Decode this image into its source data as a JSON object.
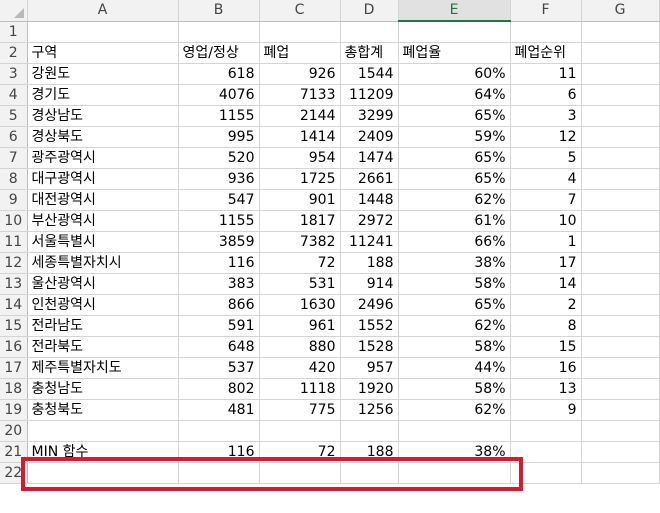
{
  "columns": [
    "A",
    "B",
    "C",
    "D",
    "E",
    "F",
    "G"
  ],
  "highlight_color": "#d9192d",
  "header_row": {
    "row_number": "2",
    "cells": [
      "구역",
      "영업/정상",
      "폐업",
      "총합계",
      "폐업율",
      "폐업순위",
      ""
    ]
  },
  "data_rows": [
    {
      "row_number": "3",
      "cells": [
        "강원도",
        "618",
        "926",
        "1544",
        "60%",
        "11",
        ""
      ]
    },
    {
      "row_number": "4",
      "cells": [
        "경기도",
        "4076",
        "7133",
        "11209",
        "64%",
        "6",
        ""
      ]
    },
    {
      "row_number": "5",
      "cells": [
        "경상남도",
        "1155",
        "2144",
        "3299",
        "65%",
        "3",
        ""
      ]
    },
    {
      "row_number": "6",
      "cells": [
        "경상북도",
        "995",
        "1414",
        "2409",
        "59%",
        "12",
        ""
      ]
    },
    {
      "row_number": "7",
      "cells": [
        "광주광역시",
        "520",
        "954",
        "1474",
        "65%",
        "5",
        ""
      ]
    },
    {
      "row_number": "8",
      "cells": [
        "대구광역시",
        "936",
        "1725",
        "2661",
        "65%",
        "4",
        ""
      ]
    },
    {
      "row_number": "9",
      "cells": [
        "대전광역시",
        "547",
        "901",
        "1448",
        "62%",
        "7",
        ""
      ]
    },
    {
      "row_number": "10",
      "cells": [
        "부산광역시",
        "1155",
        "1817",
        "2972",
        "61%",
        "10",
        ""
      ]
    },
    {
      "row_number": "11",
      "cells": [
        "서울특별시",
        "3859",
        "7382",
        "11241",
        "66%",
        "1",
        ""
      ]
    },
    {
      "row_number": "12",
      "cells": [
        "세종특별자치시",
        "116",
        "72",
        "188",
        "38%",
        "17",
        ""
      ]
    },
    {
      "row_number": "13",
      "cells": [
        "울산광역시",
        "383",
        "531",
        "914",
        "58%",
        "14",
        ""
      ]
    },
    {
      "row_number": "14",
      "cells": [
        "인천광역시",
        "866",
        "1630",
        "2496",
        "65%",
        "2",
        ""
      ]
    },
    {
      "row_number": "15",
      "cells": [
        "전라남도",
        "591",
        "961",
        "1552",
        "62%",
        "8",
        ""
      ]
    },
    {
      "row_number": "16",
      "cells": [
        "전라북도",
        "648",
        "880",
        "1528",
        "58%",
        "15",
        ""
      ]
    },
    {
      "row_number": "17",
      "cells": [
        "제주특별자치도",
        "537",
        "420",
        "957",
        "44%",
        "16",
        ""
      ]
    },
    {
      "row_number": "18",
      "cells": [
        "충청남도",
        "802",
        "1118",
        "1920",
        "58%",
        "13",
        ""
      ]
    },
    {
      "row_number": "19",
      "cells": [
        "충청북도",
        "481",
        "775",
        "1256",
        "62%",
        "9",
        ""
      ]
    }
  ],
  "row_1": {
    "row_number": "1"
  },
  "row_20": {
    "row_number": "20"
  },
  "min_row": {
    "row_number": "21",
    "cells": [
      "MIN 함수",
      "116",
      "72",
      "188",
      "38%",
      "",
      ""
    ]
  },
  "row_22": {
    "row_number": "22"
  }
}
